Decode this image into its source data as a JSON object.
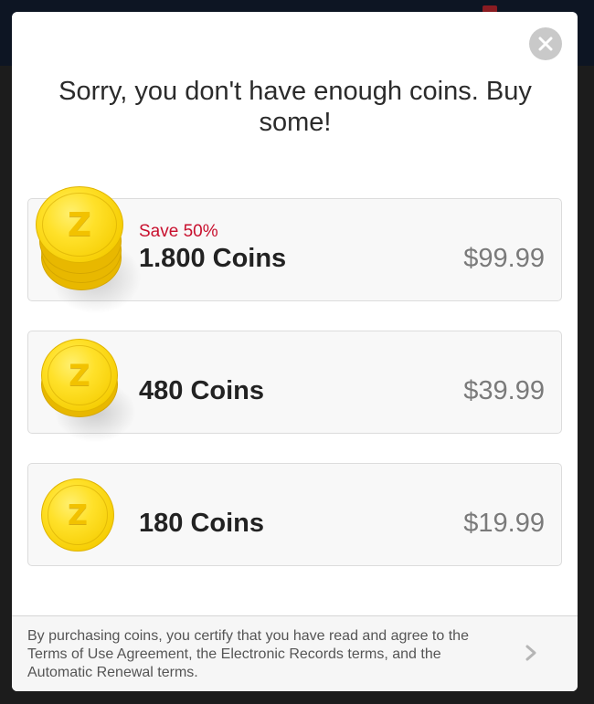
{
  "dialog": {
    "title": "Sorry, you don't have enough coins. Buy some!",
    "close_icon": "close-icon"
  },
  "packages": [
    {
      "badge": "Save 50%",
      "coins": "1.800 Coins",
      "price": "$99.99",
      "icon": "coin-stack-large-icon"
    },
    {
      "badge": "",
      "coins": "480 Coins",
      "price": "$39.99",
      "icon": "coin-stack-medium-icon"
    },
    {
      "badge": "",
      "coins": "180 Coins",
      "price": "$19.99",
      "icon": "coin-icon"
    }
  ],
  "footer": {
    "terms_text": "By purchasing coins, you certify that you have read and agree to the Terms of Use Agreement, the Electronic Records terms, and the Automatic Renewal terms.",
    "chevron_icon": "chevron-right-icon"
  },
  "colors": {
    "accent_red": "#c8102e",
    "coin_gold": "#ffe12a",
    "price_gray": "#7a7a7a"
  }
}
